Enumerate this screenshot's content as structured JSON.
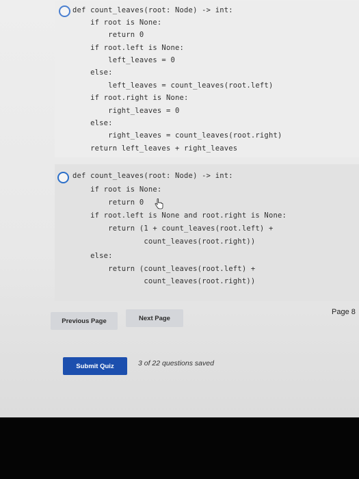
{
  "options": [
    {
      "lines": [
        "def count_leaves(root: Node) -> int:",
        "    if root is None:",
        "        return 0",
        "    if root.left is None:",
        "        left_leaves = 0",
        "    else:",
        "        left_leaves = count_leaves(root.left)",
        "    if root.right is None:",
        "        right_leaves = 0",
        "    else:",
        "        right_leaves = count_leaves(root.right)",
        "    return left_leaves + right_leaves"
      ]
    },
    {
      "lines": [
        "def count_leaves(root: Node) -> int:",
        "    if root is None:",
        "        return 0",
        "    if root.left is None and root.right is None:",
        "        return (1 + count_leaves(root.left) +",
        "                count_leaves(root.right))",
        "",
        "    else:",
        "        return (count_leaves(root.left) +",
        "                count_leaves(root.right))"
      ]
    }
  ],
  "pager": {
    "previous_label": "Previous Page",
    "next_label": "Next Page",
    "page_label": "Page 8"
  },
  "footer": {
    "submit_label": "Submit Quiz",
    "saved_status": "3 of 22 questions saved"
  },
  "colors": {
    "accent": "#1c4fae",
    "radio": "#2b6fc9"
  },
  "icons": {
    "cursor": "hand-pointer-icon"
  }
}
